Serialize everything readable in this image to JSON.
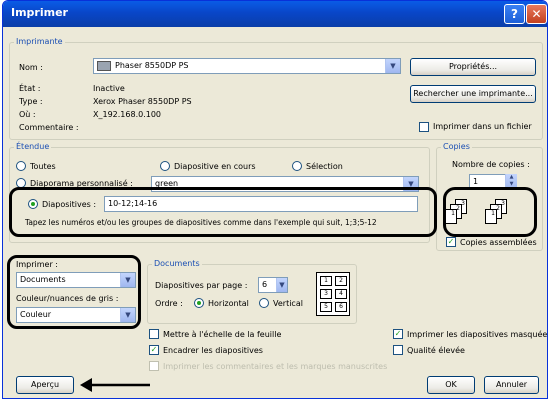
{
  "window": {
    "title": "Imprimer",
    "help": "?",
    "close": "✕"
  },
  "printer": {
    "section": "Imprimante",
    "name_label": "Nom :",
    "name_value": "Phaser 8550DP PS",
    "properties_button": "Propriétés...",
    "find_button": "Rechercher une imprimante...",
    "print_to_file": "Imprimer dans un fichier",
    "status_label": "État :",
    "status_value": "Inactive",
    "type_label": "Type :",
    "type_value": "Xerox Phaser 8550DP PS",
    "where_label": "Où :",
    "where_value": "X_192.168.0.100",
    "comment_label": "Commentaire :"
  },
  "range": {
    "section": "Étendue",
    "all": "Toutes",
    "current_slide": "Diapositive en cours",
    "selection": "Sélection",
    "custom_show": "Diaporama personnalisé :",
    "custom_show_value": "green",
    "slides": "Diapositives :",
    "slides_value": "10-12;14-16",
    "hint": "Tapez les numéros et/ou les groupes de diapositives comme dans l'exemple qui suit, 1;3;5-12"
  },
  "copies": {
    "section": "Copies",
    "count_label": "Nombre de copies :",
    "count_value": "1",
    "collate": "Copies assemblées",
    "pages": [
      "1",
      "2",
      "3",
      "1",
      "2",
      "3"
    ]
  },
  "print_what": {
    "label": "Imprimer :",
    "value": "Documents",
    "color_label": "Couleur/nuances de gris :",
    "color_value": "Couleur"
  },
  "documents": {
    "section": "Documents",
    "per_page_label": "Diapositives par page :",
    "per_page_value": "6",
    "order_label": "Ordre :",
    "horizontal": "Horizontal",
    "vertical": "Vertical",
    "preview_cells": [
      "1",
      "2",
      "3",
      "4",
      "5",
      "6"
    ]
  },
  "options": {
    "scale_to_fit": "Mettre à l'échelle de la feuille",
    "frame_slides": "Encadrer les diapositives",
    "print_comments": "Imprimer les commentaires et les marques manuscrites",
    "hidden_slides": "Imprimer les diapositives masquées",
    "high_quality": "Qualité élevée"
  },
  "footer": {
    "preview": "Aperçu",
    "ok": "OK",
    "cancel": "Annuler"
  },
  "colors": {
    "accent": "#1b4fb3",
    "title_bar": "#0a5ce6",
    "dialog_bg": "#ece9d8"
  }
}
